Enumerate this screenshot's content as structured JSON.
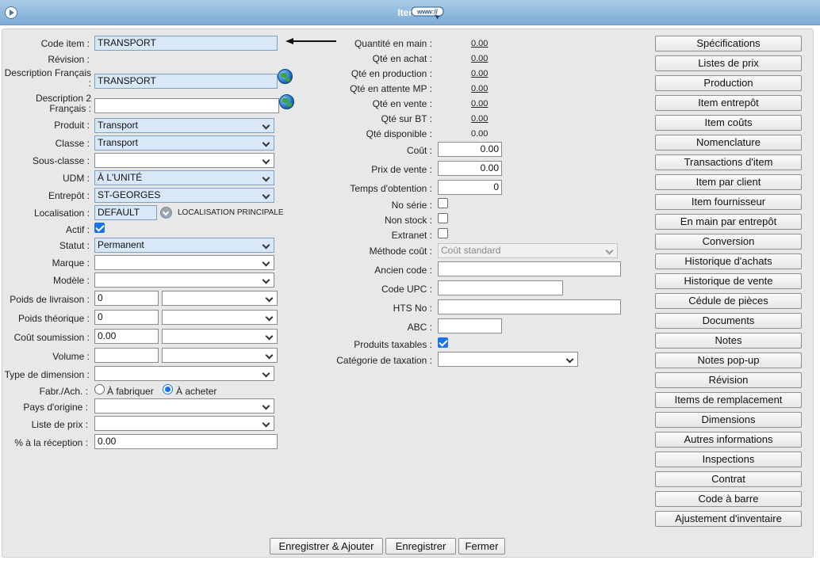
{
  "window": {
    "title": "Items",
    "www_label": "www://"
  },
  "left": {
    "code_item": {
      "label": "Code item :",
      "value": "TRANSPORT"
    },
    "revision": {
      "label": "Révision :"
    },
    "description_fr": {
      "label": "Description Français :",
      "value": "TRANSPORT"
    },
    "description2_fr": {
      "label": "Description 2 Français :",
      "value": ""
    },
    "produit": {
      "label": "Produit :",
      "value": "Transport"
    },
    "classe": {
      "label": "Classe :",
      "value": "Transport"
    },
    "sous_classe": {
      "label": "Sous-classe :",
      "value": ""
    },
    "udm": {
      "label": "UDM :",
      "value": "À L'UNITÉ"
    },
    "entrepot": {
      "label": "Entrepôt :",
      "value": "ST-GEORGES"
    },
    "localisation": {
      "label": "Localisation :",
      "value": "DEFAULT",
      "note": "LOCALISATION PRINCIPALE"
    },
    "actif": {
      "label": "Actif :",
      "checked": true
    },
    "statut": {
      "label": "Statut :",
      "value": "Permanent"
    },
    "marque": {
      "label": "Marque :",
      "value": ""
    },
    "modele": {
      "label": "Modèle :",
      "value": ""
    },
    "poids_livraison": {
      "label": "Poids de livraison :",
      "value": "0",
      "unit": ""
    },
    "poids_theorique": {
      "label": "Poids théorique :",
      "value": "0",
      "unit": ""
    },
    "cout_soumission": {
      "label": "Coût soumission :",
      "value": "0.00",
      "unit": ""
    },
    "volume": {
      "label": "Volume :",
      "value": "",
      "unit": ""
    },
    "type_dimension": {
      "label": "Type de dimension :",
      "value": ""
    },
    "fabr_ach": {
      "label": "Fabr./Ach. :",
      "option_fabriquer": "À fabriquer",
      "option_acheter": "À acheter",
      "selected": "acheter"
    },
    "pays_origine": {
      "label": "Pays d'origine :",
      "value": ""
    },
    "liste_prix": {
      "label": "Liste de prix :",
      "value": ""
    },
    "pct_reception": {
      "label": "% à la réception :",
      "value": "0.00"
    }
  },
  "middle": {
    "qte_en_main": {
      "label": "Quantité en main :",
      "value": "0.00"
    },
    "qte_en_achat": {
      "label": "Qté en achat :",
      "value": "0.00"
    },
    "qte_en_production": {
      "label": "Qté en production :",
      "value": "0.00"
    },
    "qte_en_attente_mp": {
      "label": "Qté en attente MP :",
      "value": "0.00"
    },
    "qte_en_vente": {
      "label": "Qté en vente :",
      "value": "0.00"
    },
    "qte_sur_bt": {
      "label": "Qté sur BT :",
      "value": "0.00"
    },
    "qte_disponible": {
      "label": "Qté disponible :",
      "value": "0.00"
    },
    "cout": {
      "label": "Coût :",
      "value": "0.00"
    },
    "prix_vente": {
      "label": "Prix de vente :",
      "value": "0.00"
    },
    "temps_obtention": {
      "label": "Temps d'obtention :",
      "value": "0"
    },
    "no_serie": {
      "label": "No série :",
      "checked": false
    },
    "non_stock": {
      "label": "Non stock :",
      "checked": false
    },
    "extranet": {
      "label": "Extranet :",
      "checked": false
    },
    "methode_cout": {
      "label": "Méthode coût :",
      "value": "Coût standard"
    },
    "ancien_code": {
      "label": "Ancien code :",
      "value": ""
    },
    "code_upc": {
      "label": "Code UPC :",
      "value": ""
    },
    "hts_no": {
      "label": "HTS No :",
      "value": ""
    },
    "abc": {
      "label": "ABC :",
      "value": ""
    },
    "produits_taxables": {
      "label": "Produits taxables :",
      "checked": true
    },
    "categorie_taxation": {
      "label": "Catégorie de taxation :",
      "value": ""
    }
  },
  "side_buttons": [
    "Spécifications",
    "Listes de prix",
    "Production",
    "Item entrepôt",
    "Item coûts",
    "Nomenclature",
    "Transactions d'item",
    "Item par client",
    "Item fournisseur",
    "En main par entrepôt",
    "Conversion",
    "Historique d'achats",
    "Historique de vente",
    "Cédule de pièces",
    "Documents",
    "Notes",
    "Notes pop-up",
    "Révision",
    "Items de remplacement",
    "Dimensions",
    "Autres informations",
    "Inspections",
    "Contrat",
    "Code à barre",
    "Ajustement d'inventaire"
  ],
  "footer": {
    "save_add": "Enregistrer & Ajouter",
    "save": "Enregistrer",
    "close": "Fermer"
  },
  "colors": {
    "title_bar": "#7cabd6",
    "highlight_field": "#d9e8f8",
    "panel": "#e8e8e8",
    "checkbox": "#1a73e8"
  }
}
